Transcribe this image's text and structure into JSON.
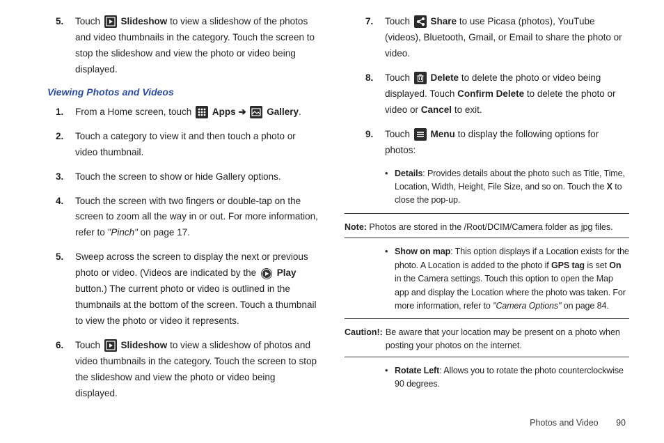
{
  "left": {
    "item5top": {
      "num": "5.",
      "pre": "Touch ",
      "icon": "slideshow-icon",
      "bold": "Slideshow",
      "post": " to view a slideshow of the photos and video thumbnails in the category. Touch the screen to stop the slideshow and view the photo or video being displayed."
    },
    "subheading": "Viewing Photos and Videos",
    "s1": {
      "num": "1.",
      "pre": "From a Home screen, touch ",
      "appsBold": "Apps",
      "arrow": " ➔ ",
      "galleryBold": "Gallery",
      "end": "."
    },
    "s2": {
      "num": "2.",
      "text": "Touch a category to view it and then touch a photo or video thumbnail."
    },
    "s3": {
      "num": "3.",
      "text": "Touch the screen to show or hide Gallery options."
    },
    "s4": {
      "num": "4.",
      "pre": "Touch the screen with two fingers or double-tap on the screen to zoom all the way in or out. For more information, refer to ",
      "ital": "\"Pinch\" ",
      "post": " on page 17."
    },
    "s5": {
      "num": "5.",
      "pre": "Sweep across the screen to display the next or previous photo or video. (Videos are indicated by the ",
      "playBold": "Play",
      "post1": " button.) The current photo or video is outlined in the thumbnails at the bottom of the screen. Touch a thumbnail to view the photo or video it represents."
    },
    "s6": {
      "num": "6.",
      "pre": "Touch ",
      "bold": "Slideshow",
      "post": " to view a slideshow of photos and video thumbnails in the category. Touch the screen to stop the slideshow and view the photo or video being displayed."
    }
  },
  "right": {
    "s7": {
      "num": "7.",
      "pre": "Touch ",
      "bold": "Share",
      "post": " to use Picasa (photos), YouTube (videos), Bluetooth, Gmail, or Email to share the photo or video."
    },
    "s8": {
      "num": "8.",
      "pre": "Touch ",
      "bold1": "Delete",
      "mid1": " to delete the photo or video being displayed. Touch ",
      "bold2": "Confirm Delete",
      "mid2": " to delete the photo or video or ",
      "bold3": "Cancel",
      "end": " to exit."
    },
    "s9": {
      "num": "9.",
      "pre": "Touch ",
      "bold": "Menu",
      "post": " to display the following options for photos:"
    },
    "b_details": {
      "label": "Details",
      "text": ": Provides details about the photo such as Title, Time, Location, Width, Height, File Size, and so on. Touch the ",
      "xbold": "X",
      "end": " to close the pop-up."
    },
    "note": {
      "label": "Note:",
      "text": " Photos are stored in the /Root/DCIM/Camera folder as jpg files."
    },
    "b_showmap": {
      "label": "Show on map",
      "t1": ": This option displays if a Location exists for the photo. A Location is added to the photo if ",
      "bold1": "GPS tag",
      "t2": " is set ",
      "bold2": "On",
      "t3": " in the Camera settings. Touch this option to open the Map app and display the Location where the photo was taken. For more information, refer to ",
      "ital": "\"Camera Options\" ",
      "t4": " on page 84."
    },
    "caution": {
      "label": "Caution!:",
      "text": "Be aware that your location may be present on a photo when posting your photos on the internet."
    },
    "b_rotate": {
      "label": "Rotate Left",
      "text": ": Allows you to rotate the photo counterclockwise 90 degrees."
    }
  },
  "footer": {
    "section": "Photos and Video",
    "page": "90"
  }
}
